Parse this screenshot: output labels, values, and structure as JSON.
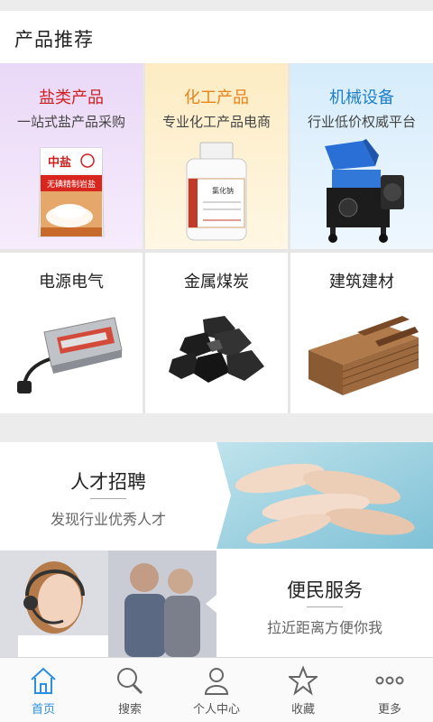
{
  "section": {
    "title": "产品推荐"
  },
  "categories": [
    {
      "name": "盐类产品",
      "sub": "一站式盐产品采购",
      "name_color": "#d02020"
    },
    {
      "name": "化工产品",
      "sub": "专业化工产品电商",
      "name_color": "#e8831a"
    },
    {
      "name": "机械设备",
      "sub": "行业低价权威平台",
      "name_color": "#1f7fc6"
    },
    {
      "name": "电源电气"
    },
    {
      "name": "金属煤炭"
    },
    {
      "name": "建筑建材"
    }
  ],
  "salt_package": {
    "brand": "中盐",
    "label": "无碘精制岩盐"
  },
  "chem_bottle": {
    "label": "氯化钠"
  },
  "banners": {
    "recruit": {
      "title": "人才招聘",
      "desc": "发现行业优秀人才"
    },
    "service": {
      "title": "便民服务",
      "desc": "拉近距离方便你我"
    }
  },
  "tabbar": {
    "items": [
      {
        "label": "首页",
        "icon": "home-icon"
      },
      {
        "label": "搜索",
        "icon": "search-icon"
      },
      {
        "label": "个人中心",
        "icon": "user-icon"
      },
      {
        "label": "收藏",
        "icon": "star-icon"
      },
      {
        "label": "更多",
        "icon": "more-icon"
      }
    ],
    "active_color": "#2a8fe0",
    "inactive_color": "#555555"
  }
}
